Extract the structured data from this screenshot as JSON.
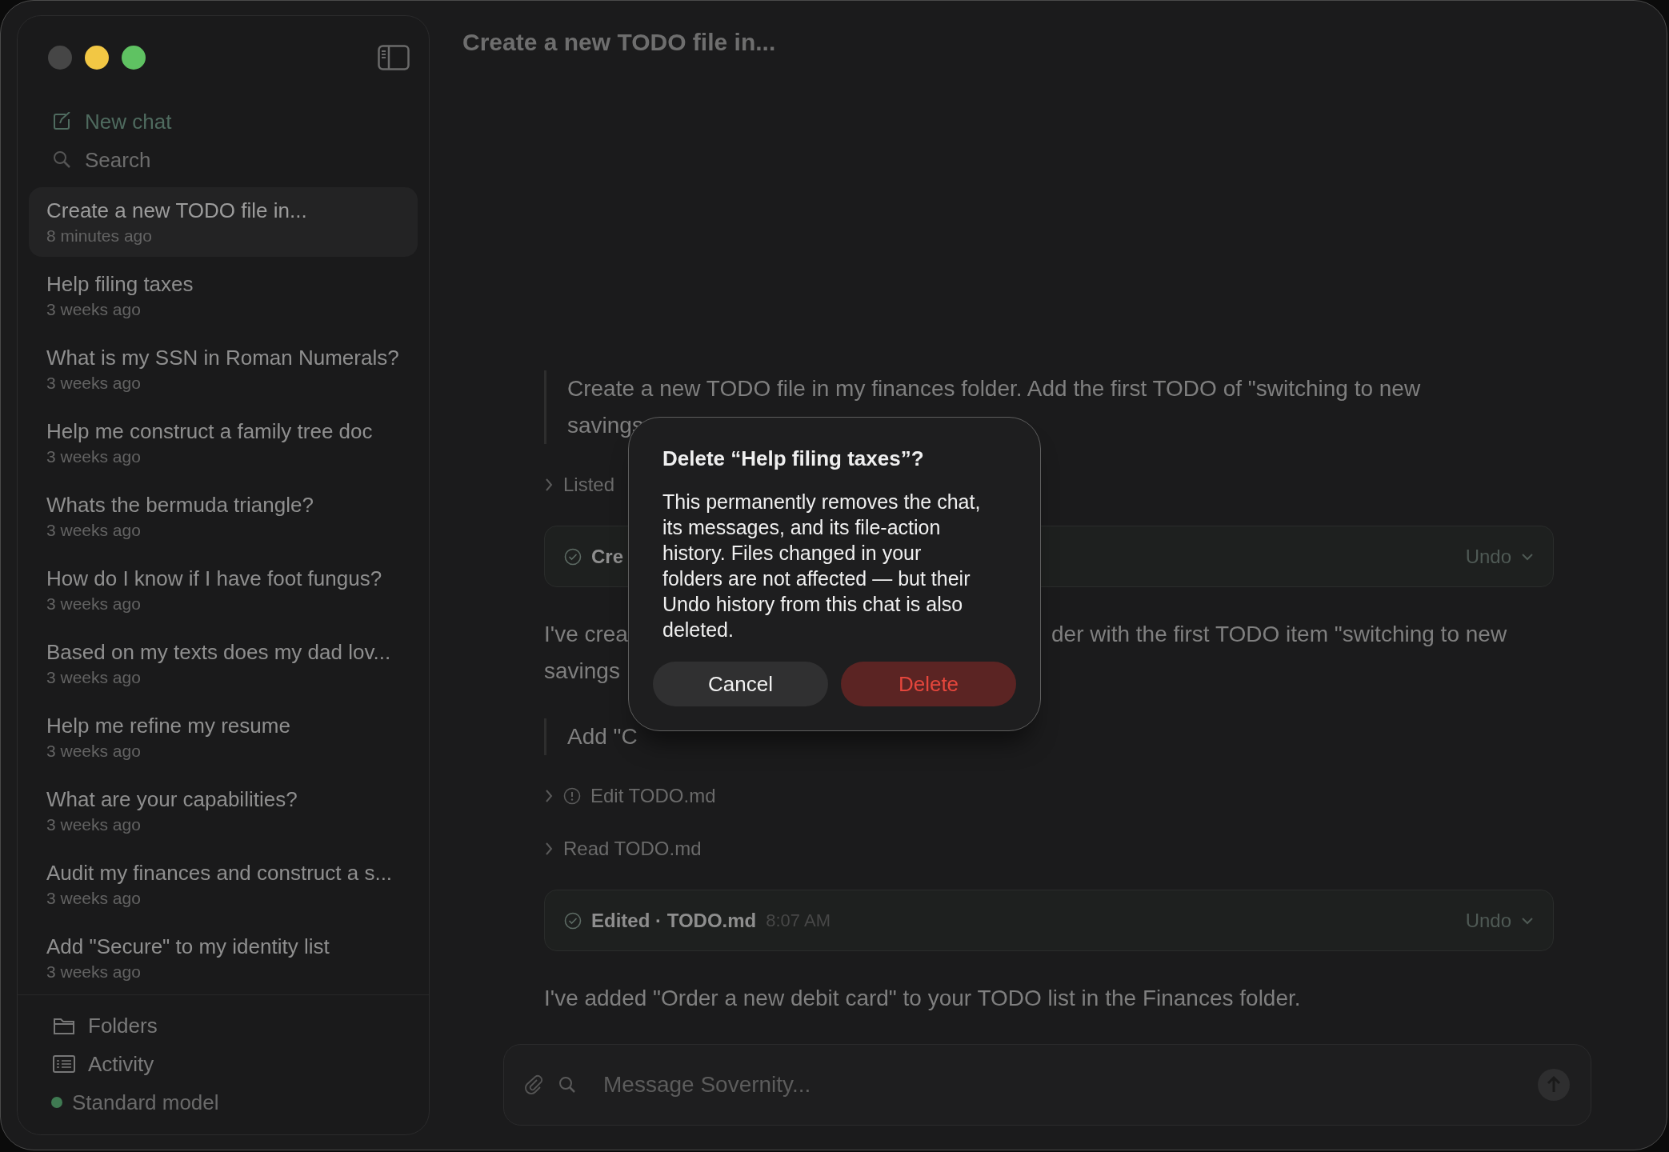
{
  "window": {
    "title": "Create a new TODO file in..."
  },
  "sidebar": {
    "actions": [
      {
        "kind": "new",
        "label": "New chat"
      },
      {
        "kind": "search",
        "label": "Search"
      }
    ],
    "chats": [
      {
        "title": "Create a new TODO file in...",
        "time": "8 minutes ago",
        "selected": true
      },
      {
        "title": "Help filing taxes",
        "time": "3 weeks ago",
        "selected": false
      },
      {
        "title": "What is my SSN in Roman Numerals?",
        "time": "3 weeks ago",
        "selected": false
      },
      {
        "title": "Help me construct a family tree doc",
        "time": "3 weeks ago",
        "selected": false
      },
      {
        "title": "Whats the bermuda triangle?",
        "time": "3 weeks ago",
        "selected": false
      },
      {
        "title": "How do I know if I have foot fungus?",
        "time": "3 weeks ago",
        "selected": false
      },
      {
        "title": "Based on my texts does my dad lov...",
        "time": "3 weeks ago",
        "selected": false
      },
      {
        "title": "Help me refine my resume",
        "time": "3 weeks ago",
        "selected": false
      },
      {
        "title": "What are your capabilities?",
        "time": "3 weeks ago",
        "selected": false
      },
      {
        "title": "Audit my finances and construct a s...",
        "time": "3 weeks ago",
        "selected": false
      },
      {
        "title": "Add \"Secure\" to my identity list",
        "time": "3 weeks ago",
        "selected": false
      }
    ],
    "footer": [
      {
        "kind": "folder",
        "label": "Folders"
      },
      {
        "kind": "activity",
        "label": "Activity"
      },
      {
        "kind": "model",
        "label": "Standard model"
      }
    ]
  },
  "chat": {
    "items": [
      {
        "kind": "quote",
        "lines": [
          [
            "Create a new TODO file in my finances folder. Add the first TODO of \"switching to new"
          ],
          [
            "savings"
          ]
        ]
      },
      {
        "kind": "tool",
        "label": "Listed"
      },
      {
        "kind": "card",
        "label": "Cre",
        "action": "Undo"
      },
      {
        "kind": "text",
        "lines": [
          [
            "I've crea",
            "der with the first TODO item \"switching to new"
          ],
          [
            "savings"
          ]
        ]
      },
      {
        "kind": "quote",
        "lines": [
          [
            "Add \"C"
          ]
        ]
      },
      {
        "kind": "tool",
        "label": "Edit TODO.md",
        "warning": true
      },
      {
        "kind": "tool",
        "label": "Read TODO.md"
      },
      {
        "kind": "card",
        "label": "Edited · TODO.md",
        "time": "8:07 AM",
        "action": "Undo"
      },
      {
        "kind": "text",
        "lines": [
          [
            "I've added \"Order a new debit card\" to your TODO list in the Finances folder."
          ]
        ]
      }
    ]
  },
  "composer": {
    "placeholder": "Message Sovernity..."
  },
  "dialog": {
    "title": "Delete “Help filing taxes”?",
    "body": "This permanently removes the chat, its messages, and its file-action history. Files changed in your folders are not affected — but their Undo history from this chat is also deleted.",
    "buttons": [
      {
        "kind": "cancel",
        "label": "Cancel"
      },
      {
        "kind": "destructive",
        "label": "Delete"
      }
    ]
  }
}
